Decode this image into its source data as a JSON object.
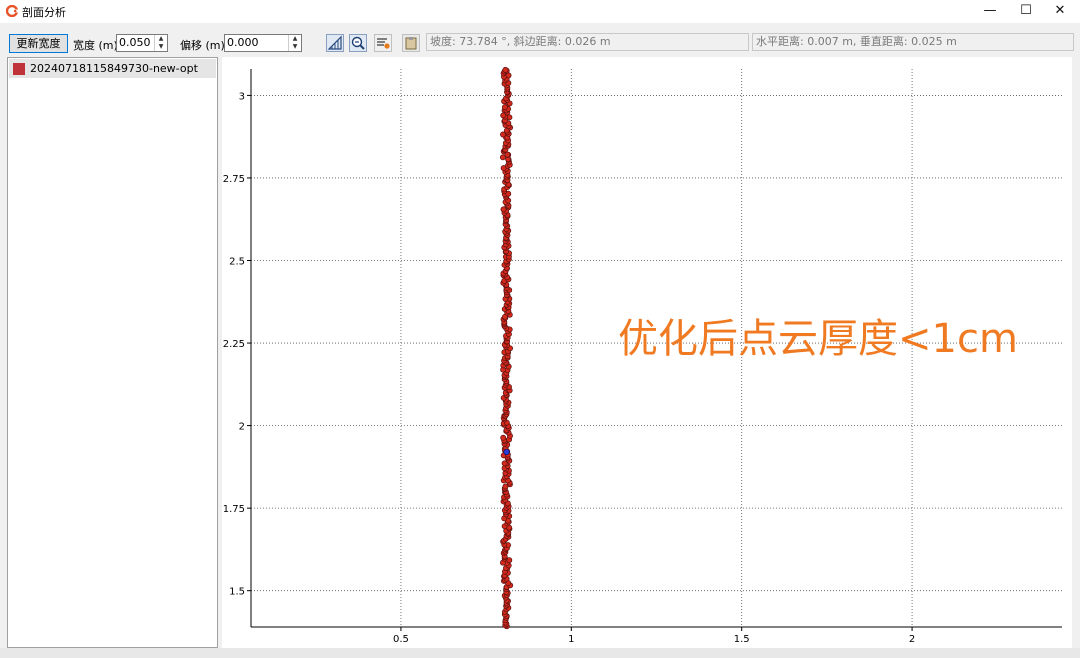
{
  "window": {
    "title": "剖面分析",
    "controls": [
      "—",
      "☐",
      "✕"
    ]
  },
  "toolbar": {
    "update_button": "更新宽度",
    "width_label": "宽度 (m)",
    "width_value": "0.050",
    "offset_label": "偏移 (m)",
    "offset_value": "0.000",
    "tool_icons": [
      "slope-measure-icon",
      "zoom-icon",
      "settings-list-icon",
      "clipboard-icon"
    ],
    "slope_info": "坡度: 73.784 °, 斜边距离: 0.026 m",
    "distance_info": "水平距离: 0.007 m, 垂直距离: 0.025 m"
  },
  "layers": [
    {
      "name": "20240718115849730-new-opt",
      "color": "#c0323a"
    }
  ],
  "overlay_text": "优化后点云厚度<1cm",
  "chart_data": {
    "type": "scatter",
    "xlim": [
      0.06,
      2.44
    ],
    "ylim": [
      1.39,
      3.08
    ],
    "x_ticks": [
      0.5,
      1,
      1.5,
      2
    ],
    "x_tick_labels": [
      "0.5",
      "1",
      "1.5",
      "2"
    ],
    "y_ticks": [
      1.5,
      1.75,
      2,
      2.25,
      2.5,
      2.75,
      3
    ],
    "y_tick_labels": [
      "1.5",
      "1.75",
      "2",
      "2.25",
      "2.5",
      "2.75",
      "3"
    ],
    "grid": true,
    "grid_style": "dotted",
    "series": [
      {
        "color": "#d42a1c",
        "edge_color": "#5a1010",
        "x_center": 0.81,
        "x_spread": 0.006,
        "y_from": 1.39,
        "y_to": 3.08
      }
    ],
    "marker_point": {
      "x": 0.81,
      "y": 1.92,
      "color": "#2a3bd6"
    }
  }
}
